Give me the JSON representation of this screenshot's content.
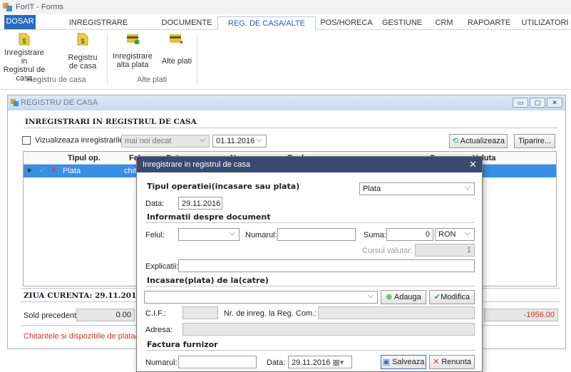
{
  "app": {
    "title": "ForIT - Forms"
  },
  "tabs": [
    "DOSAR",
    "INREGISTRARE DOCUMENTE",
    "DOCUMENTE",
    "REG. DE CASA/ALTE PLATI",
    "POS/HORECA",
    "GESTIUNE",
    "CRM",
    "RAPOARTE",
    "UTILIZATORI"
  ],
  "ribbon": {
    "btn1": [
      "Inregistrare in",
      "Registrul de",
      "casa"
    ],
    "btn2": [
      "Registru",
      "de casa"
    ],
    "btn3": [
      "Inregistrare",
      "alta plata"
    ],
    "btn4": "Alte plati",
    "group1": "Registru de casa",
    "group2": "Alte plati",
    "colors": {
      "accent": "#2b6cc2",
      "green": "#3aa04a",
      "yellow": "#e8c030"
    }
  },
  "window": {
    "title": "REGISTRU DE CASA",
    "controls": [
      "▭",
      "▢",
      "✕"
    ],
    "section": "INREGISTRARI IN REGISTRUL DE CASA",
    "filter": {
      "checkbox_label": "Vizualizeaza inregistrarile",
      "mode": "mai noi decat",
      "date": "01.11.2016"
    },
    "refresh_label": "Actualizeaza",
    "print_label": "Tiparire...",
    "grid": {
      "headers": [
        "Tipul op.",
        "Fel",
        "Data",
        "Nr",
        "Expl",
        "Suma",
        "Valuta"
      ],
      "row": {
        "tip": "Plata",
        "fel": "chit"
      }
    },
    "current_day": "ZIUA CURENTA: 29.11.2016",
    "sold_label": "Sold precedent:",
    "sold_value": "0.00",
    "sold_right": "-1956.00",
    "footer_note": "Chitantele si dispozitiile de plata/incasare"
  },
  "dialog": {
    "title": "Inregistrare in registrul de casa",
    "close": "✕",
    "op_label": "Tipul operatiei(incasare sau plata)",
    "op_value": "Plata",
    "data_label": "Data:",
    "data_value": "29.11.2016",
    "doc_section": "Informatii despre document",
    "felul_label": "Felul:",
    "numarul_label": "Numarul:",
    "suma_label": "Suma:",
    "suma_value": "0",
    "currency": "RON",
    "curs_label": "Cursul valutar:",
    "curs_value": "1",
    "expl_label": "Explicatii:",
    "partner_section": "Incasare(plata)  de la(catre)",
    "add_label": "Adauga",
    "modify_label": "Modifica",
    "cif_label": "C.I.F.:",
    "regcom_label": "Nr. de inreg. la Reg. Com.:",
    "adresa_label": "Adresa:",
    "factura_section": "Factura furnizor",
    "f_numarul_label": "Numarul:",
    "f_data_label": "Data:",
    "f_data_value": "29.11.2016",
    "save_label": "Salveaza",
    "cancel_label": "Renunta"
  }
}
